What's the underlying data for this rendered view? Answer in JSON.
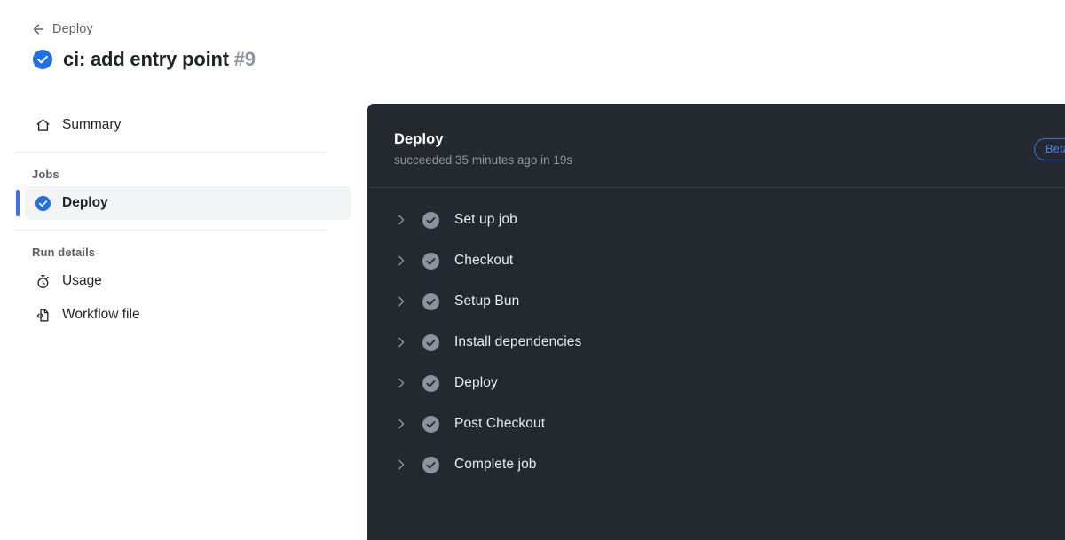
{
  "header": {
    "back_label": "Deploy",
    "back_icon": "arrow-left-icon",
    "status_icon": "check-circle-success-icon",
    "run_title": "ci: add entry point",
    "run_number": "#9"
  },
  "sidebar": {
    "top_items": [
      {
        "label": "Summary",
        "icon": "home-icon",
        "selected": false
      }
    ],
    "jobs_section": {
      "heading": "Jobs",
      "items": [
        {
          "label": "Deploy",
          "icon": "check-circle-success-icon",
          "selected": true
        }
      ]
    },
    "run_details_section": {
      "heading": "Run details",
      "items": [
        {
          "label": "Usage",
          "icon": "stopwatch-icon",
          "selected": false
        },
        {
          "label": "Workflow file",
          "icon": "file-code-icon",
          "selected": false
        }
      ]
    }
  },
  "log_panel": {
    "title": "Deploy",
    "subtitle": "succeeded 35 minutes ago in 19s",
    "badge": "Beta",
    "steps": [
      {
        "name": "Set up job",
        "status_icon": "check-circle-gray-icon",
        "chevron": "chevron-right-icon"
      },
      {
        "name": "Checkout",
        "status_icon": "check-circle-gray-icon",
        "chevron": "chevron-right-icon"
      },
      {
        "name": "Setup Bun",
        "status_icon": "check-circle-gray-icon",
        "chevron": "chevron-right-icon"
      },
      {
        "name": "Install dependencies",
        "status_icon": "check-circle-gray-icon",
        "chevron": "chevron-right-icon"
      },
      {
        "name": "Deploy",
        "status_icon": "check-circle-gray-icon",
        "chevron": "chevron-right-icon"
      },
      {
        "name": "Post Checkout",
        "status_icon": "check-circle-gray-icon",
        "chevron": "chevron-right-icon"
      },
      {
        "name": "Complete job",
        "status_icon": "check-circle-gray-icon",
        "chevron": "chevron-right-icon"
      }
    ]
  },
  "colors": {
    "success_blue": "#1f6feb",
    "accent_bar": "#3b6ff0",
    "panel_bg": "#24292f",
    "step_status_gray": "#8b949e",
    "badge_blue": "#4d7ef5"
  }
}
